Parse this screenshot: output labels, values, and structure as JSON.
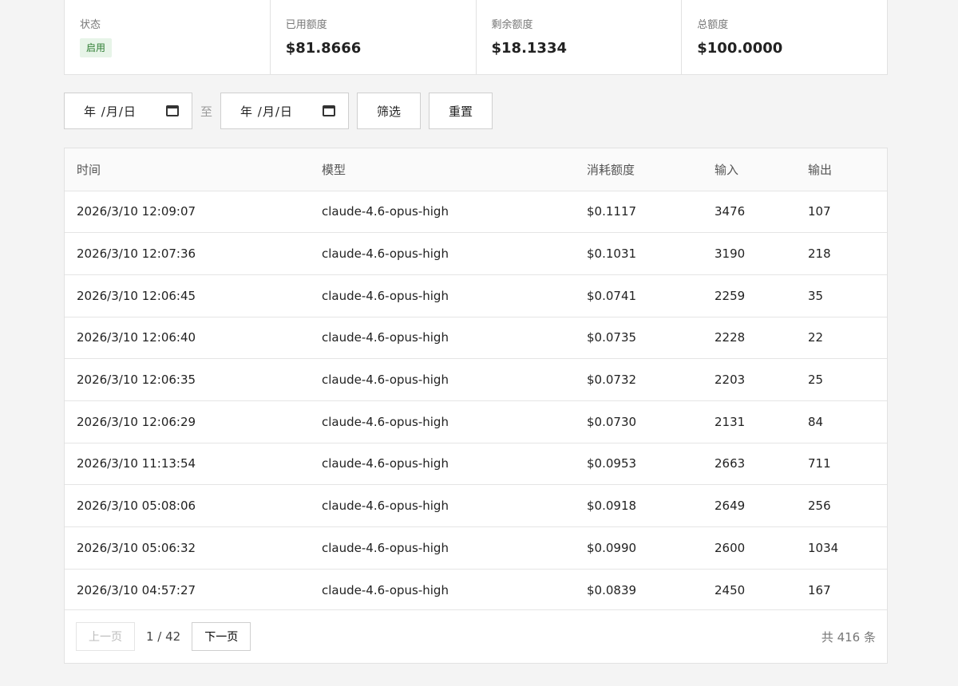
{
  "stats": {
    "status": {
      "label": "状态",
      "value": "启用"
    },
    "used": {
      "label": "已用额度",
      "value": "$81.8666"
    },
    "remaining": {
      "label": "剩余额度",
      "value": "$18.1334"
    },
    "total": {
      "label": "总额度",
      "value": "$100.0000"
    }
  },
  "filters": {
    "start_date": "年 /月/日",
    "separator": "至",
    "end_date": "年 /月/日",
    "filter_label": "筛选",
    "reset_label": "重置"
  },
  "table": {
    "headers": [
      "时间",
      "模型",
      "消耗额度",
      "输入",
      "输出"
    ],
    "rows": [
      [
        "2026/3/10 12:09:07",
        "claude-4.6-opus-high",
        "$0.1117",
        "3476",
        "107"
      ],
      [
        "2026/3/10 12:07:36",
        "claude-4.6-opus-high",
        "$0.1031",
        "3190",
        "218"
      ],
      [
        "2026/3/10 12:06:45",
        "claude-4.6-opus-high",
        "$0.0741",
        "2259",
        "35"
      ],
      [
        "2026/3/10 12:06:40",
        "claude-4.6-opus-high",
        "$0.0735",
        "2228",
        "22"
      ],
      [
        "2026/3/10 12:06:35",
        "claude-4.6-opus-high",
        "$0.0732",
        "2203",
        "25"
      ],
      [
        "2026/3/10 12:06:29",
        "claude-4.6-opus-high",
        "$0.0730",
        "2131",
        "84"
      ],
      [
        "2026/3/10 11:13:54",
        "claude-4.6-opus-high",
        "$0.0953",
        "2663",
        "711"
      ],
      [
        "2026/3/10 05:08:06",
        "claude-4.6-opus-high",
        "$0.0918",
        "2649",
        "256"
      ],
      [
        "2026/3/10 05:06:32",
        "claude-4.6-opus-high",
        "$0.0990",
        "2600",
        "1034"
      ],
      [
        "2026/3/10 04:57:27",
        "claude-4.6-opus-high",
        "$0.0839",
        "2450",
        "167"
      ]
    ]
  },
  "pager": {
    "prev_label": "上一页",
    "page_info": "1 / 42",
    "next_label": "下一页",
    "total_text": "共 416 条"
  }
}
